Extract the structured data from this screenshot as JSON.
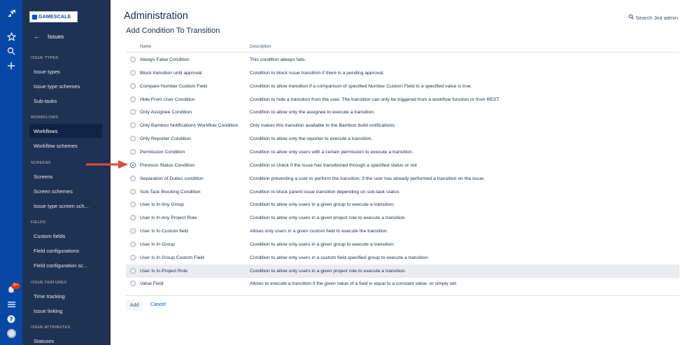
{
  "logo": {
    "text": "GAMESCALE"
  },
  "sidebar": {
    "back_label": "Issues",
    "sections": [
      {
        "title": "ISSUE TYPES",
        "items": [
          "Issue types",
          "Issue type schemes",
          "Sub-tasks"
        ]
      },
      {
        "title": "WORKFLOWS",
        "items": [
          "Workflows",
          "Workflow schemes"
        ]
      },
      {
        "title": "SCREENS",
        "items": [
          "Screens",
          "Screen schemes",
          "Issue type screen sch..."
        ]
      },
      {
        "title": "FIELDS",
        "items": [
          "Custom fields",
          "Field configurations",
          "Field configuration sc..."
        ]
      },
      {
        "title": "ISSUE FEATURES",
        "items": [
          "Time tracking",
          "Issue linking"
        ]
      },
      {
        "title": "ISSUE ATTRIBUTES",
        "items": [
          "Statuses"
        ]
      }
    ],
    "active_item": "Workflows"
  },
  "nav": {
    "notification_count": "9+"
  },
  "header": {
    "title": "Administration",
    "search_label": "Search Jira admin"
  },
  "page": {
    "subtitle": "Add Condition To Transition"
  },
  "table": {
    "col_name": "Name",
    "col_description": "Description",
    "rows": [
      {
        "name": "Always False Condition",
        "desc": "This condition always fails."
      },
      {
        "name": "Block transition until approval",
        "desc": "Condition to block issue transition if there is a pending approval."
      },
      {
        "name": "Compare Number Custom Field",
        "desc": "Condition to allow transition if a comparison of specified Number Custom Field to a specified value is true."
      },
      {
        "name": "Hide From User Condition",
        "desc": "Condition to hide a transition from the user. The transition can only be triggered from a workflow function or from REST."
      },
      {
        "name": "Only Assignee Condition",
        "desc": "Condition to allow only the assignee to execute a transition."
      },
      {
        "name": "Only Bamboo Notifications Workflow Condition",
        "desc": "Only makes this transition available to the Bamboo build notifications."
      },
      {
        "name": "Only Reporter Condition",
        "desc": "Condition to allow only the reporter to execute a transition."
      },
      {
        "name": "Permission Condition",
        "desc": "Condition to allow only users with a certain permission to execute a transition."
      },
      {
        "name": "Previous Status Condition",
        "desc": "Condition to check if the issue has transitioned through a specified status or not"
      },
      {
        "name": "Separation of Duties condition",
        "desc": "Condition preventing a user to perform the transition, if the user has already performed a transition on the issue."
      },
      {
        "name": "Sub-Task Blocking Condition",
        "desc": "Condition to block parent issue transition depending on sub-task status."
      },
      {
        "name": "User Is In Any Group",
        "desc": "Condition to allow only users in a given group to execute a transition."
      },
      {
        "name": "User Is In Any Project Role",
        "desc": "Condition to allow only users in a given project role to execute a transition."
      },
      {
        "name": "User Is In Custom field",
        "desc": "Allows only users in a given custom field to execute the transition."
      },
      {
        "name": "User Is In Group",
        "desc": "Condition to allow only users in a given group to execute a transition."
      },
      {
        "name": "User Is In Group Custom Field",
        "desc": "Condition to allow only users in a custom field-specified group to execute a transition."
      },
      {
        "name": "User Is In Project Role",
        "desc": "Condition to allow only users in a given project role to execute a transition."
      },
      {
        "name": "Value Field",
        "desc": "Allows to execute a transition if the given value of a field is equal to a constant value, or simply set."
      }
    ],
    "selected_row": "Previous Status Condition",
    "hovered_row": "User Is In Project Role"
  },
  "actions": {
    "add_label": "Add",
    "cancel_label": "Cancel"
  },
  "colors": {
    "rail": "#0747a6",
    "sidebar": "#1e3254",
    "link": "#0052cc",
    "arrow": "#e5483c"
  }
}
